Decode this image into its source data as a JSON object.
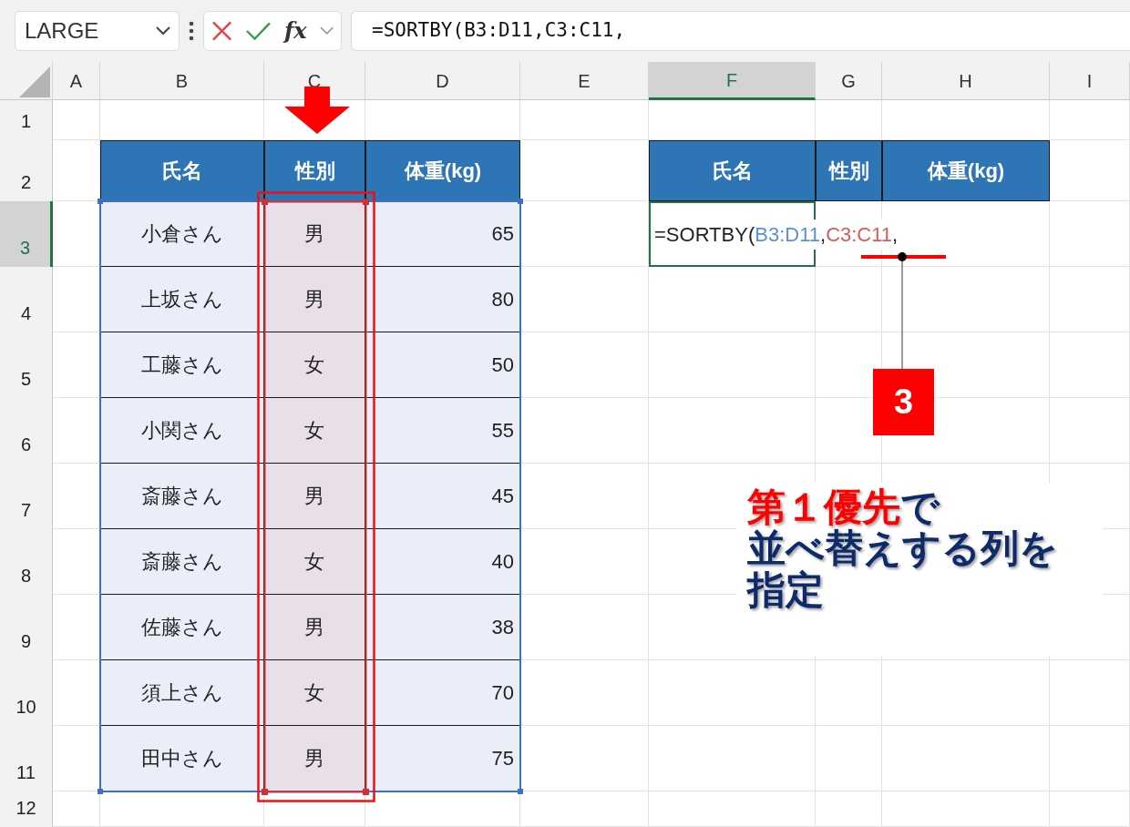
{
  "formula_bar": {
    "name_box": "LARGE",
    "function_label": "fx",
    "formula": "=SORTBY(B3:D11,C3:C11,"
  },
  "columns": [
    {
      "label": "A",
      "selected": false
    },
    {
      "label": "B",
      "selected": false
    },
    {
      "label": "C",
      "selected": false
    },
    {
      "label": "D",
      "selected": false
    },
    {
      "label": "E",
      "selected": false
    },
    {
      "label": "F",
      "selected": true
    },
    {
      "label": "G",
      "selected": false
    },
    {
      "label": "H",
      "selected": false
    },
    {
      "label": "I",
      "selected": false
    }
  ],
  "rows": [
    {
      "label": "1",
      "selected": false
    },
    {
      "label": "2",
      "selected": false
    },
    {
      "label": "3",
      "selected": true
    },
    {
      "label": "4",
      "selected": false
    },
    {
      "label": "5",
      "selected": false
    },
    {
      "label": "6",
      "selected": false
    },
    {
      "label": "7",
      "selected": false
    },
    {
      "label": "8",
      "selected": false
    },
    {
      "label": "9",
      "selected": false
    },
    {
      "label": "10",
      "selected": false
    },
    {
      "label": "11",
      "selected": false
    },
    {
      "label": "12",
      "selected": false
    }
  ],
  "left_table": {
    "headers": [
      "氏名",
      "性別",
      "体重(kg)"
    ],
    "rows": [
      [
        "小倉さん",
        "男",
        "65"
      ],
      [
        "上坂さん",
        "男",
        "80"
      ],
      [
        "工藤さん",
        "女",
        "50"
      ],
      [
        "小関さん",
        "女",
        "55"
      ],
      [
        "斎藤さん",
        "男",
        "45"
      ],
      [
        "斎藤さん",
        "女",
        "40"
      ],
      [
        "佐藤さん",
        "男",
        "38"
      ],
      [
        "須上さん",
        "女",
        "70"
      ],
      [
        "田中さん",
        "男",
        "75"
      ]
    ]
  },
  "right_table": {
    "headers": [
      "氏名",
      "性別",
      "体重(kg)"
    ]
  },
  "active_cell": {
    "parts": [
      {
        "text": "=SORTBY(",
        "color": "#222222"
      },
      {
        "text": "B3:D11",
        "color": "#5b8fd9"
      },
      {
        "text": ",",
        "color": "#222222"
      },
      {
        "text": "C3:C11",
        "color": "#d45b5b"
      },
      {
        "text": ",",
        "color": "#222222"
      }
    ]
  },
  "step_badge": "3",
  "callout": {
    "lines": [
      [
        {
          "text": "第１優先",
          "color": "#ff0000"
        },
        {
          "text": "で",
          "color": "#0d2a6b"
        }
      ],
      [
        {
          "text": "並べ替えする列を",
          "color": "#0d2a6b"
        }
      ],
      [
        {
          "text": "指定",
          "color": "#0d2a6b"
        }
      ]
    ]
  }
}
